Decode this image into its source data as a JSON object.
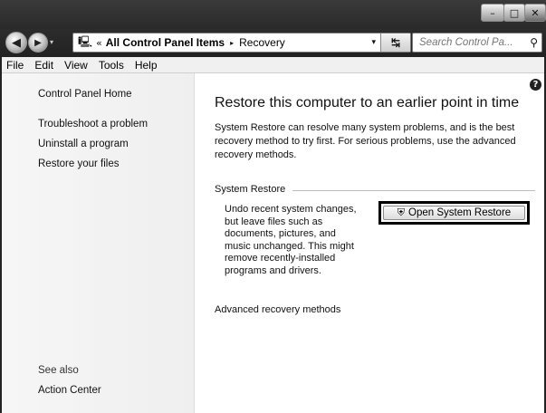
{
  "titlebar": {
    "min_glyph": "–",
    "max_glyph": "□",
    "close_glyph": "✕"
  },
  "nav": {
    "back_glyph": "◀",
    "forward_glyph": "▶",
    "drop_glyph": "▾",
    "breadcrumb": {
      "chevron": "«",
      "parts": [
        "All Control Panel Items",
        "Recovery"
      ],
      "separator": "▸",
      "icon": "control-panel-icon"
    },
    "refresh_glyph": "↹",
    "search": {
      "placeholder": "Search Control Pa...",
      "icon": "search-icon",
      "glyph": "⚲"
    }
  },
  "menu": [
    "File",
    "Edit",
    "View",
    "Tools",
    "Help"
  ],
  "sidebar": {
    "home": "Control Panel Home",
    "links": [
      "Troubleshoot a problem",
      "Uninstall a program",
      "Restore your files"
    ],
    "see_also_label": "See also",
    "see_also_links": [
      "Action Center"
    ]
  },
  "main": {
    "help_glyph": "?",
    "title": "Restore this computer to an earlier point in time",
    "intro": "System Restore can resolve many system problems, and is the best recovery method to try first. For serious problems, use the advanced recovery methods.",
    "group_label": "System Restore",
    "group_description": "Undo recent system changes, but leave files such as documents, pictures, and music unchanged. This might remove recently-installed programs and drivers.",
    "open_button": "Open System Restore",
    "shield_glyph": "⛨",
    "advanced_link": "Advanced recovery methods"
  },
  "colors": {
    "frame": "#2a2a2a",
    "sidebar_bg": "#f3f3f3",
    "content_bg": "#ffffff"
  }
}
